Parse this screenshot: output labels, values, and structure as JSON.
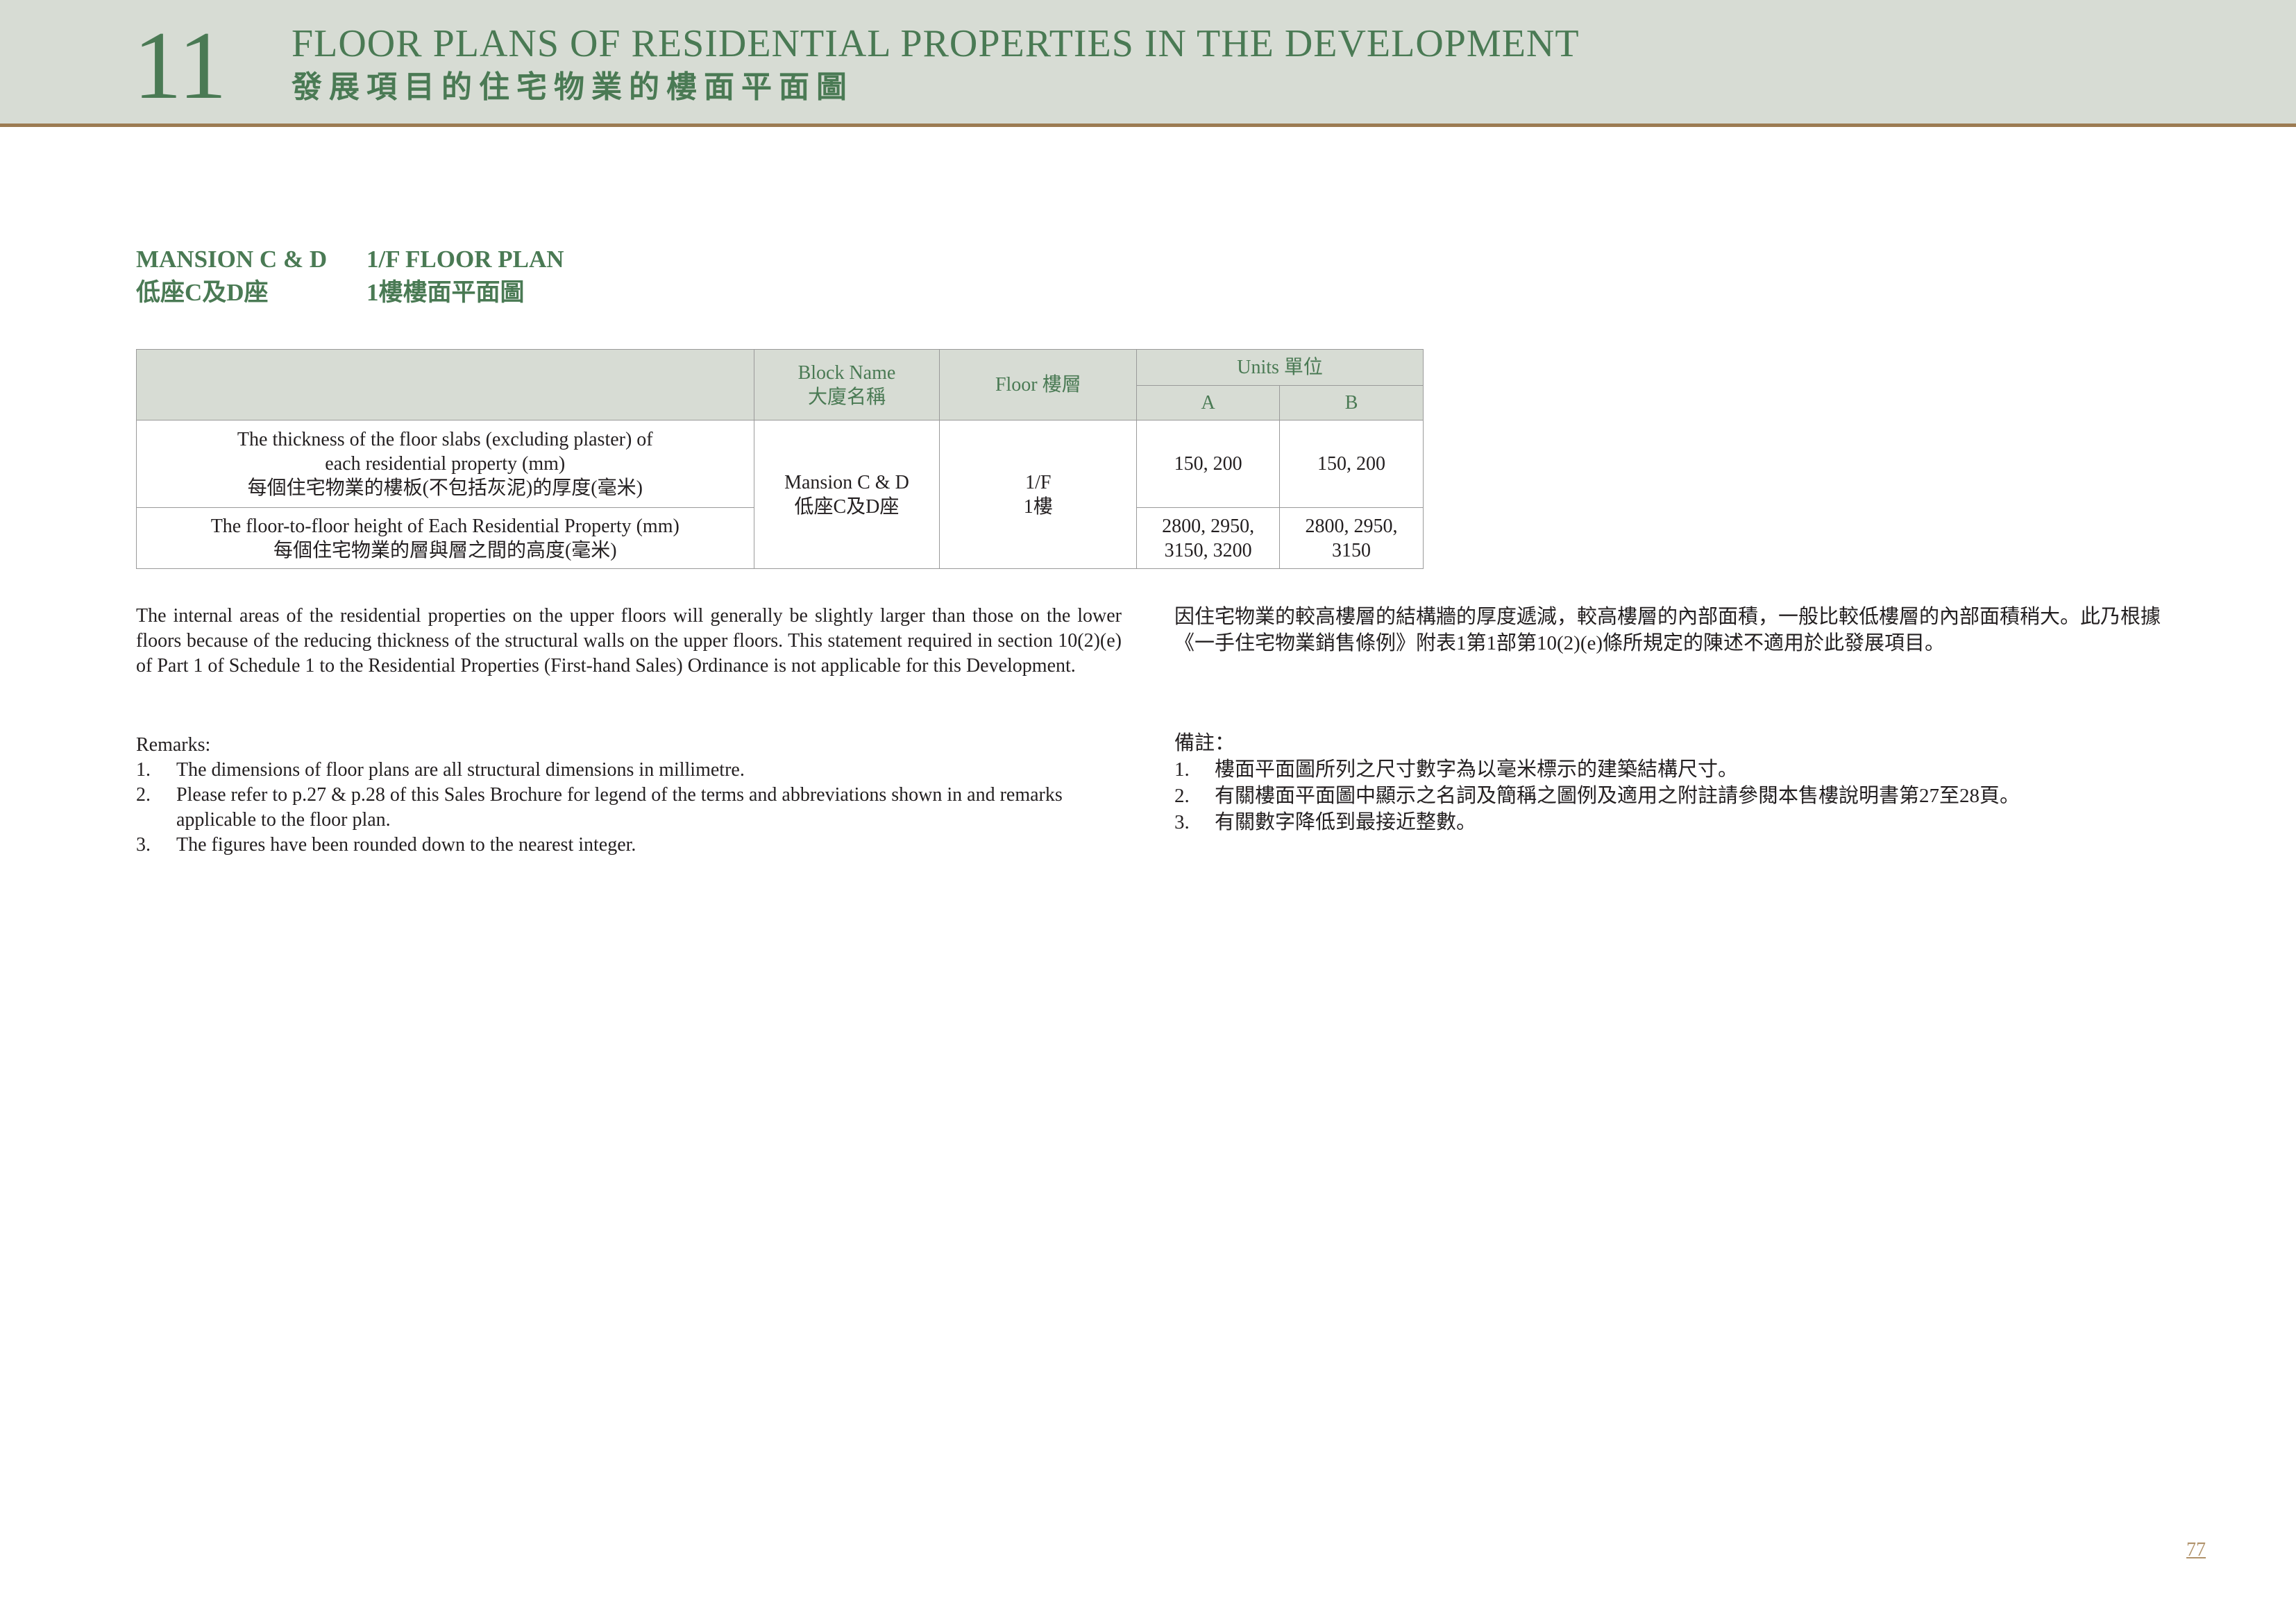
{
  "header": {
    "chapter_number": "11",
    "title_en": "FLOOR PLANS OF RESIDENTIAL PROPERTIES IN THE DEVELOPMENT",
    "title_zh": "發展項目的住宅物業的樓面平面圖"
  },
  "section": {
    "mansion_en": "MANSION C & D",
    "plan_en": "1/F FLOOR PLAN",
    "mansion_zh": "低座C及D座",
    "plan_zh": "1樓樓面平面圖"
  },
  "table": {
    "header_block_en": "Block Name",
    "header_block_zh": "大廈名稱",
    "header_floor": "Floor 樓層",
    "header_units": "Units 單位",
    "unit_a": "A",
    "unit_b": "B",
    "row1_label_en": "The thickness of the floor slabs (excluding plaster) of each residential property (mm)",
    "row1_label_zh": "每個住宅物業的樓板(不包括灰泥)的厚度(毫米)",
    "row2_label_en": "The floor-to-floor height of Each Residential Property (mm)",
    "row2_label_zh": "每個住宅物業的層與層之間的高度(毫米)",
    "block_en": "Mansion C & D",
    "block_zh": "低座C及D座",
    "floor_en": "1/F",
    "floor_zh": "1樓",
    "row1_a": "150, 200",
    "row1_b": "150, 200",
    "row2_a_line1": "2800, 2950,",
    "row2_a_line2": "3150, 3200",
    "row2_b_line1": "2800, 2950,",
    "row2_b_line2": "3150"
  },
  "statement": {
    "en": "The internal areas of the residential properties on the upper floors will generally be slightly larger than those on the lower floors because of the reducing thickness of the structural walls on the upper floors. This statement required in section 10(2)(e) of Part 1 of Schedule 1 to the Residential Properties (First-hand Sales) Ordinance is not applicable for this Development.",
    "zh": "因住宅物業的較高樓層的結構牆的厚度遞減，較高樓層的內部面積，一般比較低樓層的內部面積稍大。此乃根據《一手住宅物業銷售條例》附表1第1部第10(2)(e)條所規定的陳述不適用於此發展項目。"
  },
  "remarks_en": {
    "title": "Remarks:",
    "items": [
      {
        "num": "1.",
        "text": "The dimensions of floor plans are all structural dimensions in millimetre."
      },
      {
        "num": "2.",
        "text": "Please refer to p.27 & p.28 of this Sales Brochure for legend of the terms and abbreviations shown in and remarks applicable to the floor plan."
      },
      {
        "num": "3.",
        "text": "The figures have been rounded down to the nearest integer."
      }
    ]
  },
  "remarks_zh": {
    "title": "備註：",
    "items": [
      {
        "num": "1.",
        "text": "樓面平面圖所列之尺寸數字為以毫米標示的建築結構尺寸。"
      },
      {
        "num": "2.",
        "text": "有關樓面平面圖中顯示之名詞及簡稱之圖例及適用之附註請參閱本售樓說明書第27至28頁。"
      },
      {
        "num": "3.",
        "text": "有關數字降低到最接近整數。"
      }
    ]
  },
  "page_number": "77",
  "colors": {
    "accent_green": "#4a7a54",
    "header_bg": "#d7dcd4",
    "rule_brown": "#9c7b52",
    "page_number": "#b0926a"
  }
}
